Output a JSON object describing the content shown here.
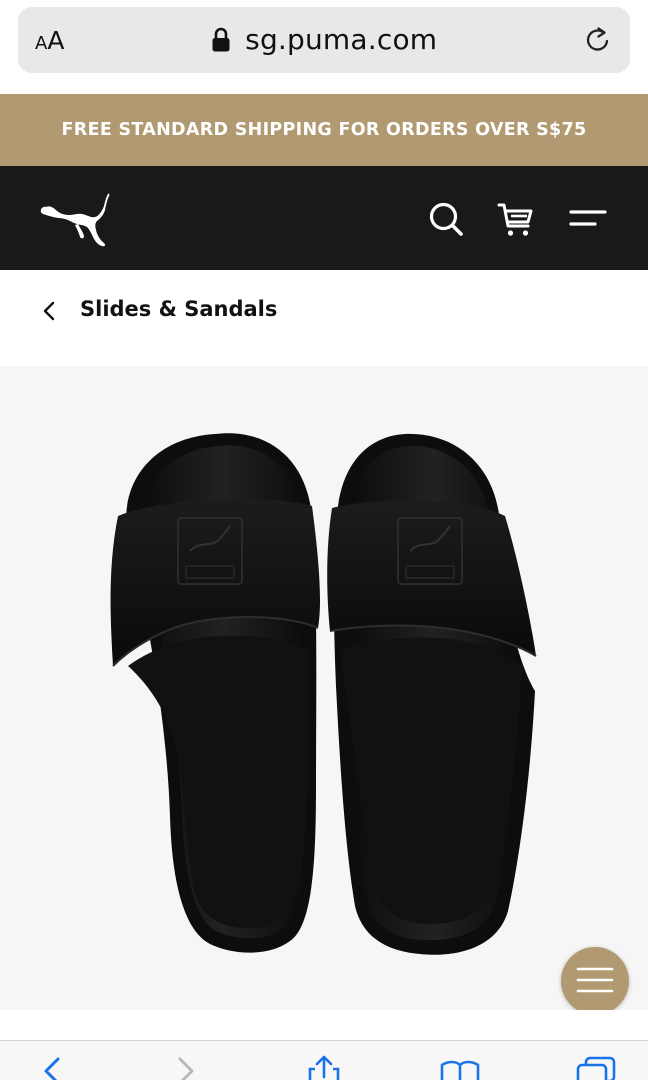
{
  "browser": {
    "aa_small": "A",
    "aa_big": "A",
    "url": "sg.puma.com",
    "icons": [
      "lock-icon",
      "reload-icon"
    ]
  },
  "promo": {
    "text": "FREE STANDARD SHIPPING FOR ORDERS OVER S$75",
    "background": "#b19a72"
  },
  "header": {
    "background": "#191919",
    "icons": [
      "puma-logo-icon",
      "search-icon",
      "cart-icon",
      "menu-icon"
    ]
  },
  "breadcrumb": {
    "label": "Slides & Sandals"
  },
  "product": {
    "image": "black-slide-sandals-pair"
  },
  "floating_menu": {
    "icon": "hamburger-icon",
    "color": "#b19a72"
  },
  "toolbar": {
    "icons": [
      "back-icon",
      "forward-icon",
      "share-icon",
      "bookmarks-icon",
      "tabs-icon"
    ],
    "accent": "#1a73e8"
  }
}
